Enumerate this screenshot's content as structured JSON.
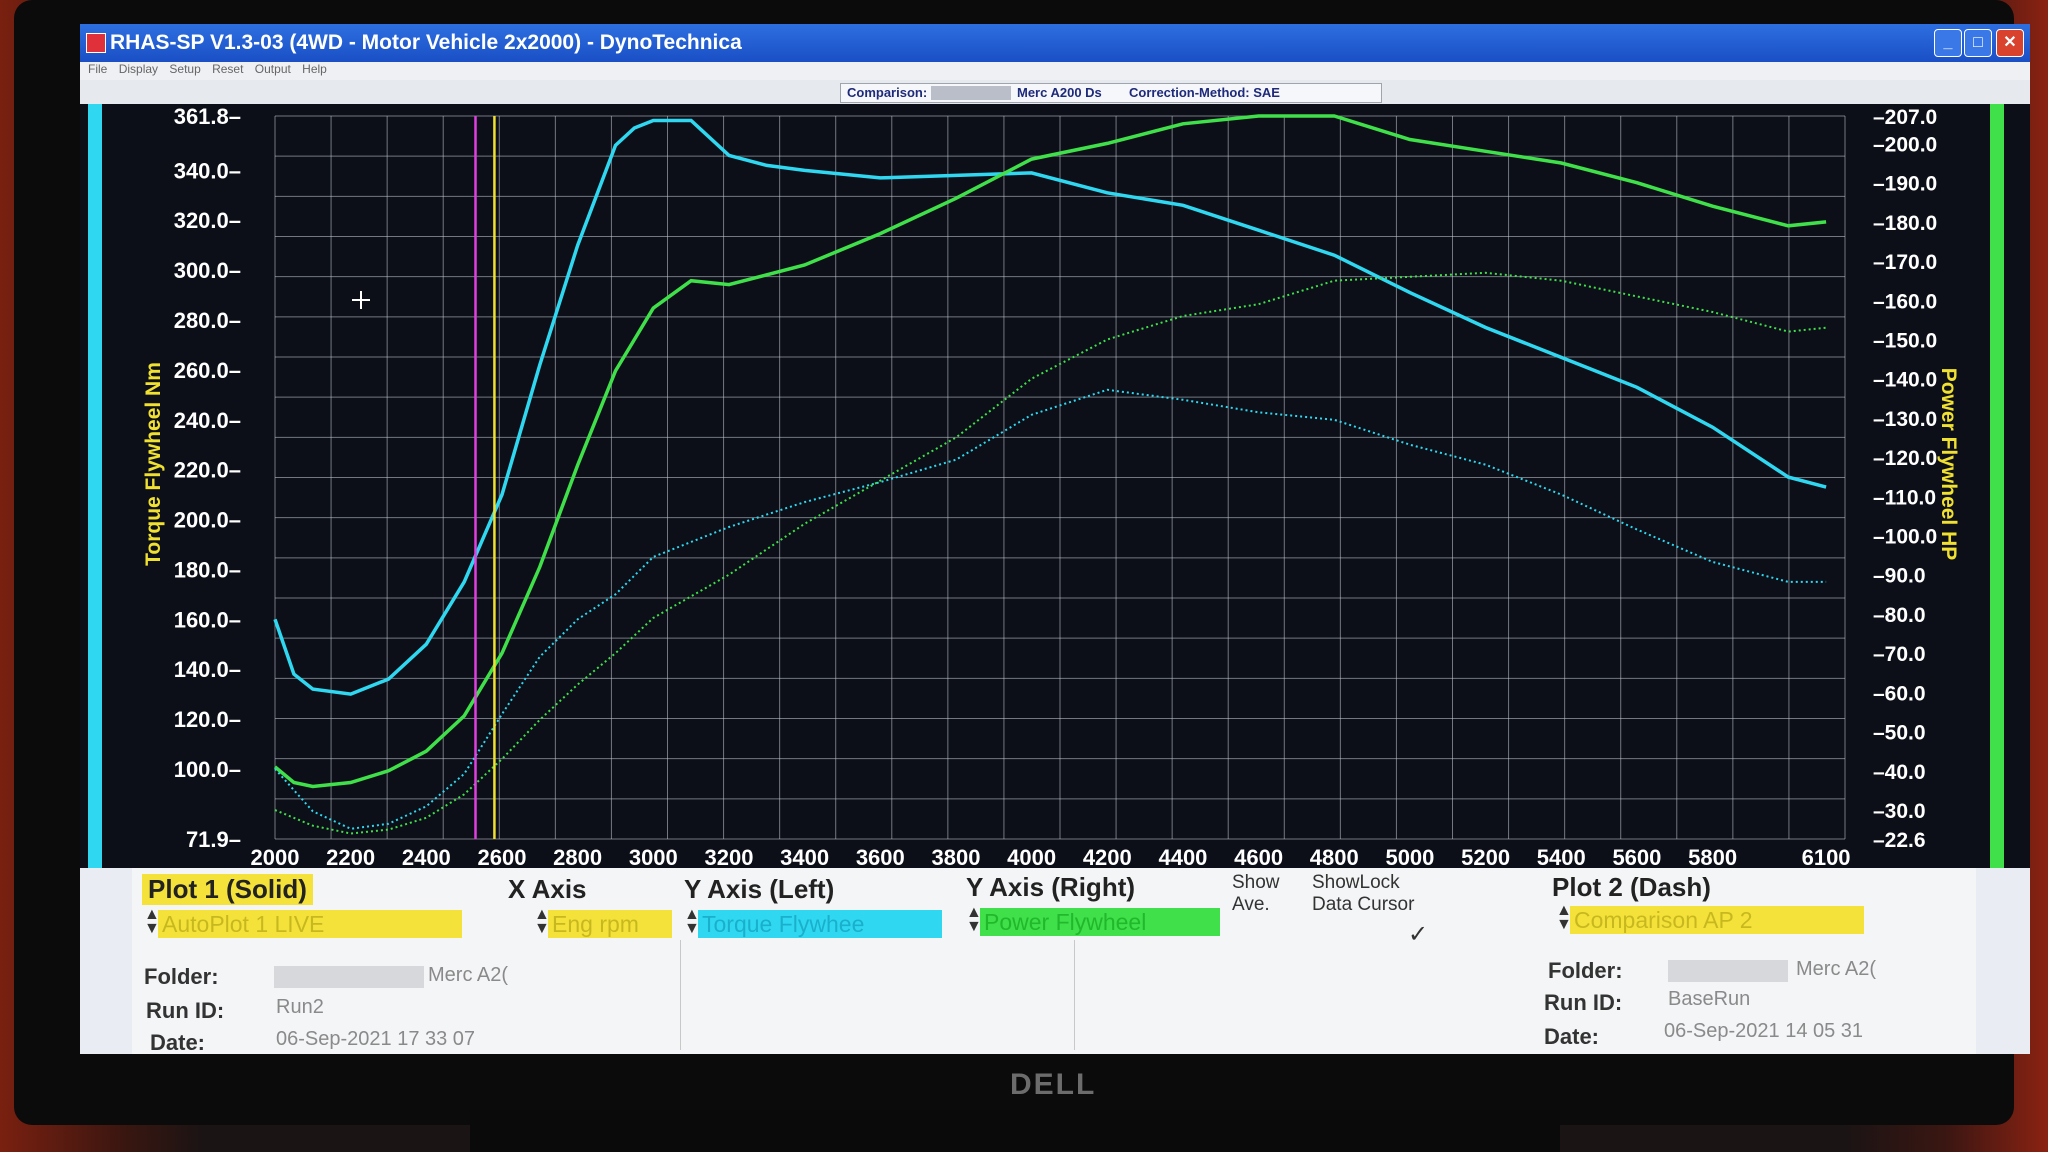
{
  "window": {
    "title": "RHAS-SP V1.3-03  (4WD - Motor Vehicle 2x2000) - DynoTechnica",
    "menu": [
      "File",
      "Display",
      "Setup",
      "Reset",
      "Output",
      "Help"
    ]
  },
  "comparison_bar": {
    "label": "Comparison:",
    "vehicle": "Merc A200 Ds",
    "correction": "Correction-Method: SAE"
  },
  "monitor": {
    "brand": "DELL"
  },
  "colors": {
    "torque": "#2fd8f0",
    "power": "#3fe04a",
    "cursor_yellow": "#f0e030",
    "cursor_magenta": "#e040e0",
    "axis_label_yellow": "#f0e030"
  },
  "chart_data": {
    "type": "line",
    "xlabel": "",
    "ylabel_left": "Torque Flywheel Nm",
    "ylabel_right": "Power Flywheel HP",
    "xlim": [
      2000,
      6150
    ],
    "ylim_left": [
      71.9,
      361.8
    ],
    "ylim_right": [
      22.6,
      207.0
    ],
    "x_ticks": [
      "2000",
      "2200",
      "2400",
      "2600",
      "2800",
      "3000",
      "3200",
      "3400",
      "3600",
      "3800",
      "4000",
      "4200",
      "4400",
      "4600",
      "4800",
      "5000",
      "5200",
      "5400",
      "5600",
      "5800",
      "6100"
    ],
    "y_ticks_left": [
      "361.8",
      "340.0",
      "320.0",
      "300.0",
      "280.0",
      "260.0",
      "240.0",
      "220.0",
      "200.0",
      "180.0",
      "160.0",
      "140.0",
      "120.0",
      "100.0",
      "71.9"
    ],
    "y_ticks_right": [
      "207.0",
      "200.0",
      "190.0",
      "180.0",
      "170.0",
      "160.0",
      "150.0",
      "140.0",
      "130.0",
      "120.0",
      "110.0",
      "100.0",
      "90.0",
      "80.0",
      "70.0",
      "60.0",
      "50.0",
      "40.0",
      "30.0",
      "22.6"
    ],
    "grid": true,
    "cursors": [
      {
        "x": 2530,
        "color": "magenta"
      },
      {
        "x": 2580,
        "color": "yellow"
      }
    ],
    "series": [
      {
        "name": "Torque Flywheel",
        "axis": "left",
        "style": "solid",
        "x": [
          2000,
          2050,
          2100,
          2200,
          2300,
          2400,
          2500,
          2600,
          2700,
          2800,
          2900,
          2950,
          3000,
          3100,
          3200,
          3300,
          3400,
          3600,
          3800,
          4000,
          4200,
          4400,
          4600,
          4800,
          5000,
          5200,
          5400,
          5600,
          5800,
          6000,
          6100
        ],
        "y": [
          160,
          138,
          132,
          130,
          136,
          150,
          175,
          210,
          262,
          310,
          350,
          357,
          360,
          360,
          346,
          342,
          340,
          337,
          338,
          339,
          331,
          326,
          316,
          306,
          291,
          277,
          265,
          253,
          237,
          217,
          213
        ]
      },
      {
        "name": "Power Flywheel",
        "axis": "right",
        "style": "solid",
        "x": [
          2000,
          2050,
          2100,
          2200,
          2300,
          2400,
          2500,
          2600,
          2700,
          2800,
          2900,
          3000,
          3100,
          3200,
          3400,
          3600,
          3800,
          4000,
          4200,
          4400,
          4600,
          4800,
          5000,
          5200,
          5400,
          5600,
          5800,
          6000,
          6100
        ],
        "y": [
          41,
          37,
          36,
          37,
          40,
          45,
          54,
          70,
          92,
          118,
          142,
          158,
          165,
          164,
          169,
          177,
          186,
          196,
          200,
          205,
          207,
          207,
          201,
          198,
          195,
          190,
          184,
          179,
          180
        ]
      },
      {
        "name": "Torque Flywheel (Comparison)",
        "axis": "left",
        "style": "dashed",
        "x": [
          2000,
          2100,
          2200,
          2300,
          2400,
          2500,
          2600,
          2700,
          2800,
          2900,
          3000,
          3200,
          3400,
          3600,
          3800,
          4000,
          4200,
          4400,
          4600,
          4800,
          5000,
          5200,
          5400,
          5600,
          5800,
          6000,
          6100
        ],
        "y": [
          100,
          83,
          76,
          78,
          85,
          98,
          122,
          145,
          160,
          170,
          185,
          197,
          207,
          215,
          224,
          242,
          252,
          248,
          243,
          240,
          230,
          222,
          210,
          196,
          183,
          175,
          175
        ]
      },
      {
        "name": "Power Flywheel (Comparison)",
        "axis": "right",
        "style": "dashed",
        "x": [
          2000,
          2100,
          2200,
          2300,
          2400,
          2500,
          2600,
          2700,
          2800,
          2900,
          3000,
          3200,
          3400,
          3600,
          3800,
          4000,
          4200,
          4400,
          4600,
          4800,
          5000,
          5200,
          5400,
          5600,
          5800,
          6000,
          6100
        ],
        "y": [
          30,
          26,
          24,
          25,
          28,
          34,
          43,
          53,
          62,
          70,
          79,
          90,
          103,
          114,
          125,
          140,
          150,
          156,
          159,
          165,
          166,
          167,
          165,
          161,
          157,
          152,
          153
        ]
      }
    ]
  },
  "panel": {
    "plot1": {
      "header": "Plot 1 (Solid)",
      "selection": "AutoPlot 1 LIVE",
      "folder_label": "Folder:",
      "folder_value": "Merc A2(",
      "runid_label": "Run ID:",
      "runid_value": "Run2",
      "date_label": "Date:",
      "date_value": "06-Sep-2021  17 33 07"
    },
    "x_axis": {
      "header": "X Axis",
      "selection": "Eng rpm"
    },
    "y_left": {
      "header": "Y Axis (Left)",
      "selection": "Torque Flywhee"
    },
    "y_right": {
      "header": "Y Axis (Right)",
      "selection": "Power Flywheel"
    },
    "show_ave": "Show\nAve.",
    "show_lock": "ShowLock\nData Cursor",
    "checkmark": "✓",
    "plot2": {
      "header": "Plot 2 (Dash)",
      "selection": "Comparison AP 2",
      "folder_label": "Folder:",
      "folder_value": "Merc A2(",
      "runid_label": "Run ID:",
      "runid_value": "BaseRun",
      "date_label": "Date:",
      "date_value": "06-Sep-2021  14 05 31"
    }
  }
}
